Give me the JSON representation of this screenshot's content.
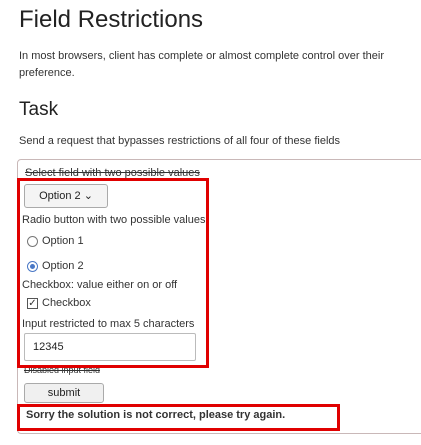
{
  "page": {
    "title": "Field Restrictions",
    "intro": "In most browsers, client has complete or almost complete control over their preference."
  },
  "task": {
    "title": "Task",
    "description": "Send a request that bypasses restrictions of all four of these fields"
  },
  "form": {
    "select_label": "Select field with two possible values",
    "select_value": "Option 2",
    "radio_label": "Radio button with two possible values",
    "radio_options": [
      "Option 1",
      "Option 2"
    ],
    "radio_selected": "Option 2",
    "checkbox_label": "Checkbox: value either on or off",
    "checkbox_text": "Checkbox",
    "checkbox_checked": true,
    "input_label": "Input restricted to max 5 characters",
    "input_value": "12345",
    "disabled_label": "Disabled input field",
    "submit_label": "submit"
  },
  "feedback": {
    "message": "Sorry the solution is not correct, please try again.",
    "highlight_color": "#e00000"
  },
  "icons": {
    "select_arrow": "chevron-down-icon",
    "checkbox_mark": "check-icon"
  }
}
